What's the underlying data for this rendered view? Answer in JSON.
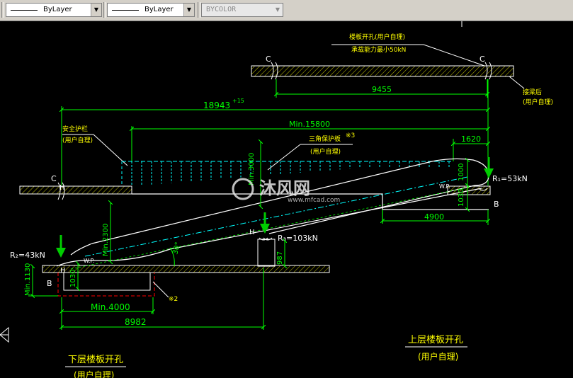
{
  "toolbar": {
    "linetype_value": "ByLayer",
    "lineweight_value": "ByLayer",
    "plotstyle_value": "BYCOLOR"
  },
  "drawing": {
    "top_note_line1": "楼板开孔(用户自理)",
    "top_note_line2": "承载能力最小50kN",
    "section_c": "C",
    "dim_9455": "9455",
    "structural_note_line1": "接梁后",
    "structural_note_line2": "(用户自理)",
    "dim_18943": "18943",
    "dim_18943_tol": "+15",
    "dim_min15800": "Min.15800",
    "safety_guard_line1": "安全护栏",
    "safety_guard_line2": "(用户自理)",
    "triangle_guard_line1": "三角保护板",
    "triangle_guard_sup": "※3",
    "triangle_guard_line2": "(用户自理)",
    "dim_1620": "1620",
    "dim_min3000": "Min.3000",
    "dim_1000": "1000",
    "dim_1030_upper": "1030",
    "reaction_r1": "R₁=53kN",
    "section_b": "B",
    "dim_4900": "4900",
    "dim_min2300": "Min.2300",
    "point_h": "H",
    "reaction_r3": "R₃=103kN",
    "dim_987": "987",
    "angle_30": "30°",
    "reaction_r2": "R₂=43kN",
    "dim_min1130": "Min.1130",
    "dim_1030_lower": "1030",
    "wp_label": "W.P.",
    "pit_note": "※2",
    "dim_min4000": "Min.4000",
    "dim_8982": "8982",
    "upper_opening_line1": "上层楼板开孔",
    "upper_opening_line2": "(用户自理)",
    "lower_opening_line1": "下层楼板开孔",
    "lower_opening_line2": "(用户自理)",
    "watermark_cn": "沐风网",
    "watermark_url": "www.mfcad.com"
  },
  "colors": {
    "background": "#000000",
    "dimension": "#00ff00",
    "line_white": "#ffffff",
    "guard_cyan": "#00ffff",
    "arrow_green": "#00cc00",
    "pit_red": "#ff0000",
    "text_yellow": "#ffff00",
    "hatch_yellow": "#c8c800"
  }
}
